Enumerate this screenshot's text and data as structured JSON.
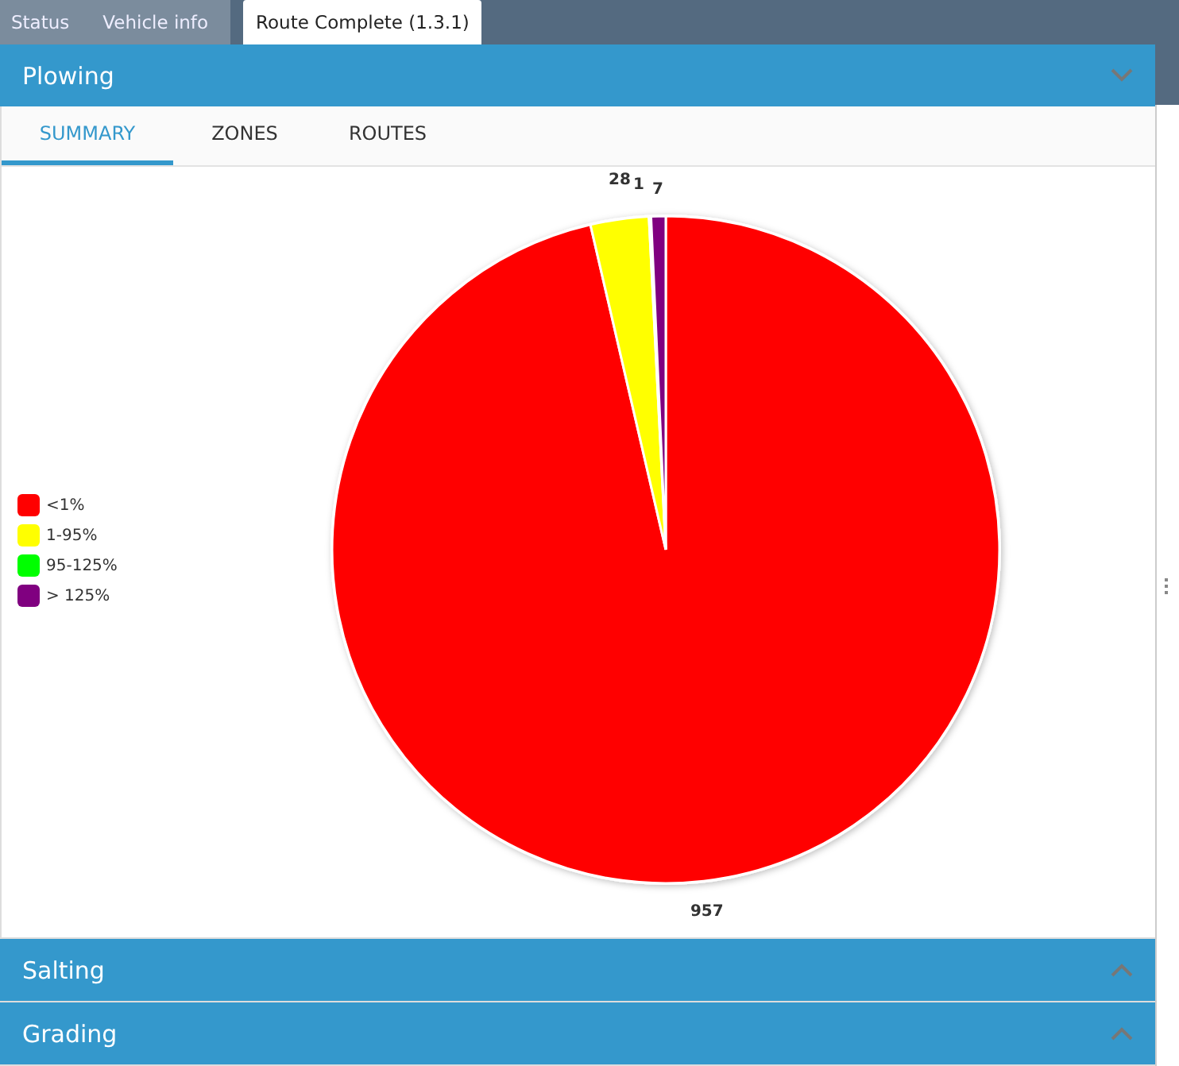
{
  "top_tabs": [
    {
      "label": "Status",
      "selected": false
    },
    {
      "label": "Vehicle info",
      "selected": false
    },
    {
      "label": "Route Complete (1.3.1)",
      "selected": true
    }
  ],
  "sections": [
    {
      "title": "Plowing",
      "expanded": true,
      "tabs": [
        {
          "label": "SUMMARY",
          "selected": true
        },
        {
          "label": "ZONES",
          "selected": false
        },
        {
          "label": "ROUTES",
          "selected": false
        }
      ],
      "chart_data": {
        "type": "pie",
        "categories": [
          "<1%",
          "1-95%",
          "95-125%",
          "> 125%"
        ],
        "values": [
          957,
          28,
          1,
          7
        ],
        "colors": [
          "#ff0000",
          "#ffff00",
          "#00ff00",
          "#800080"
        ],
        "data_labels": true,
        "legend": "left"
      }
    },
    {
      "title": "Salting",
      "expanded": false
    },
    {
      "title": "Grading",
      "expanded": false
    }
  ]
}
